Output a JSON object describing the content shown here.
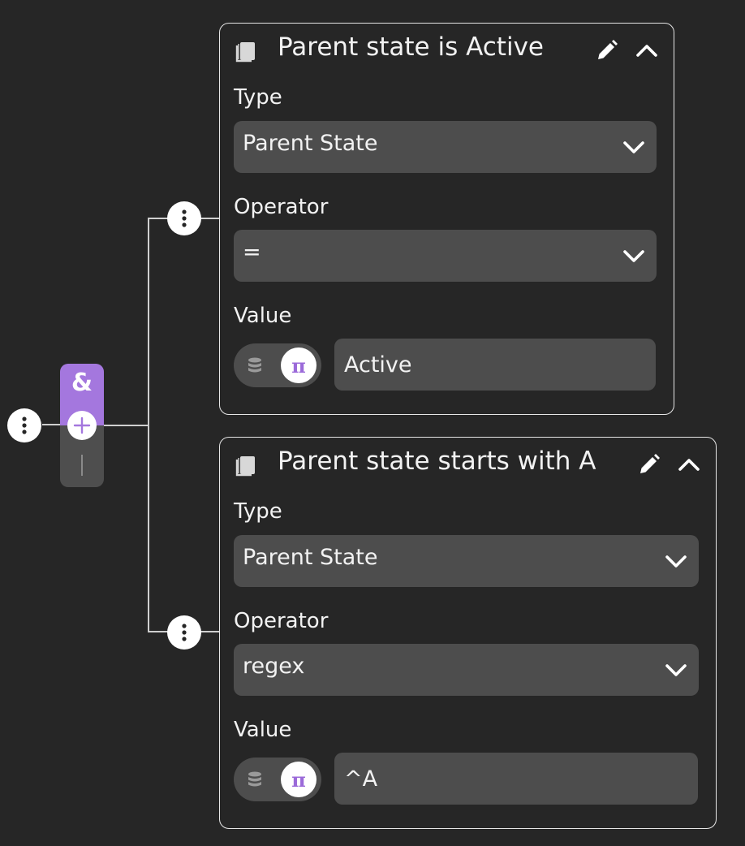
{
  "group": {
    "operator_symbol": "&"
  },
  "conditions": [
    {
      "title": "Parent state is Active",
      "type_label": "Type",
      "type_value": "Parent State",
      "operator_label": "Operator",
      "operator_value": "=",
      "value_label": "Value",
      "value_mode": "constant",
      "value": "Active"
    },
    {
      "title": "Parent state starts with A",
      "type_label": "Type",
      "type_value": "Parent State",
      "operator_label": "Operator",
      "operator_value": "regex",
      "value_label": "Value",
      "value_mode": "constant",
      "value": "^A"
    }
  ],
  "icons": {
    "node_menu": "kebab-icon",
    "add": "plus-icon",
    "condition": "book-icon",
    "edit": "pencil-icon",
    "collapse": "chevron-up-icon",
    "dropdown": "chevron-down-icon",
    "source_database": "database-icon",
    "source_constant": "pi-icon"
  },
  "colors": {
    "background": "#262626",
    "group_accent": "#a477de",
    "field_background": "#4d4d4d",
    "card_border": "#e6e6e6"
  }
}
